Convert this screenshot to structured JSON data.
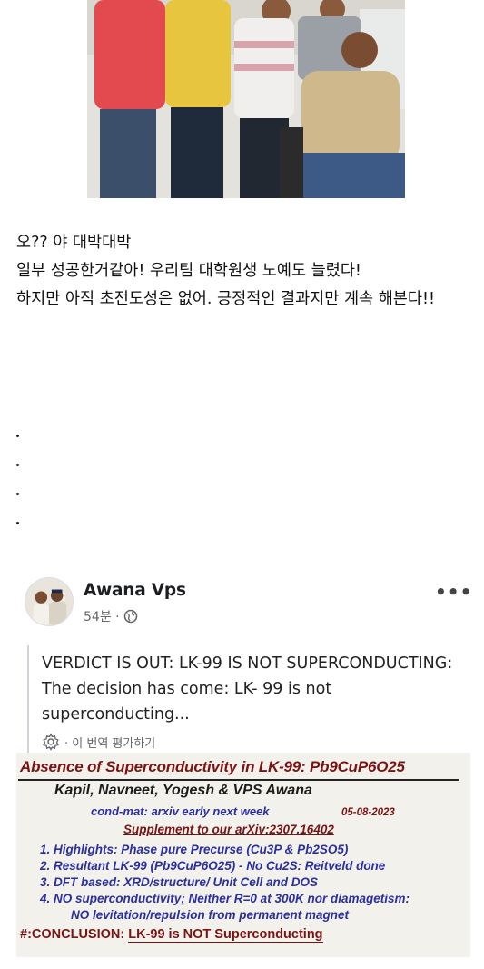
{
  "message": {
    "lines": [
      "오?? 야 대박대박",
      "일부 성공한거같아! 우리팀 대학원생 노예도 늘렸다!",
      "하지만 아직 초전도성은 없어. 긍정적인 결과지만 계속 해본다!!"
    ]
  },
  "post": {
    "author": "Awana Vps",
    "time": "54분 ·",
    "more_label": "•••",
    "quote_text": "VERDICT IS OUT: LK-99 IS NOT SUPERCONDUCTING: The decision has come: LK- 99 is not superconducting...",
    "rate_label": "· 이 번역 평가하기"
  },
  "document": {
    "title": "Absence of Superconductivity in LK-99:  Pb9CuP6O25",
    "authors": "Kapil, Navneet, Yogesh & VPS Awana",
    "cond_mat": "cond-mat: arxiv early next week",
    "date": "05-08-2023",
    "supplement": "Supplement to our arXiv:2307.16402",
    "items": [
      "1. Highlights: Phase pure Precurse (Cu3P & Pb2SO5)",
      "2. Resultant LK-99 (Pb9CuP6O25) - No Cu2S: Reitveld done",
      "3. DFT based:  XRD/structure/ Unit Cell and DOS",
      "4. NO superconductivity; Neither R=0 at 300K nor diamagetism:",
      "NO levitation/repulsion from permanent magnet"
    ],
    "conclusion_prefix": "#:CONCLUSION: ",
    "conclusion_main": "LK-99 is NOT Superconducting"
  }
}
